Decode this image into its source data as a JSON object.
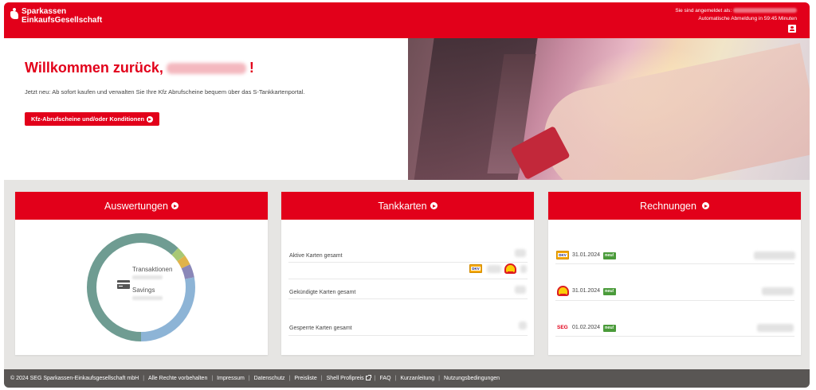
{
  "header": {
    "brand_line1": "Sparkassen",
    "brand_line2": "EinkaufsGesellschaft",
    "logged_in_label": "Sie sind angemeldet als:",
    "auto_logout": "Automatische Abmeldung in 59:45 Minuten",
    "user_icon": "user-icon"
  },
  "hero": {
    "welcome_prefix": "Willkommen zurück,",
    "welcome_suffix": "!",
    "intro": "Jetzt neu: Ab sofort kaufen und verwalten Sie Ihre Kfz Abrufscheine bequem über das S-Tankkartenportal.",
    "cta_label": "Kfz-Abrufscheine und/oder Konditionen"
  },
  "panels": {
    "auswertungen": {
      "title": "Auswertungen",
      "label_transactions": "Transaktionen",
      "label_savings": "Savings",
      "segments": [
        {
          "fraction": 0.62,
          "color": "#6f9c92"
        },
        {
          "fraction": 0.03,
          "color": "#a8c874"
        },
        {
          "fraction": 0.03,
          "color": "#e0b34a"
        },
        {
          "fraction": 0.04,
          "color": "#8a87b8"
        },
        {
          "fraction": 0.28,
          "color": "#8db4d6"
        }
      ]
    },
    "tankkarten": {
      "title": "Tankkarten",
      "rows": [
        {
          "label": "Aktive Karten gesamt"
        },
        {
          "label": "Gekündigte Karten gesamt"
        },
        {
          "label": "Gesperrte Karten gesamt"
        }
      ]
    },
    "rechnungen": {
      "title": "Rechnungen",
      "invoices": [
        {
          "provider": "dkv-logo",
          "date": "31.01.2024",
          "badge": "neu!"
        },
        {
          "provider": "shell-logo",
          "date": "31.01.2024",
          "badge": "neu!"
        },
        {
          "provider": "seg-logo",
          "date": "01.02.2024",
          "badge": "neu!"
        }
      ],
      "seg_text": "SEG"
    }
  },
  "logos": {
    "dkv_text": "DKV"
  },
  "footer": {
    "copyright": "© 2024 SEG Sparkassen-Einkaufsgesellschaft mbH",
    "links": [
      "Alle Rechte vorbehalten",
      "Impressum",
      "Datenschutz",
      "Preisliste",
      "Shell Profipreis",
      "FAQ",
      "Kurzanleitung",
      "Nutzungsbedingungen"
    ]
  },
  "colors": {
    "brand_red": "#e2001a",
    "footer_bg": "#595654",
    "badge_green": "#4a9b3a"
  }
}
